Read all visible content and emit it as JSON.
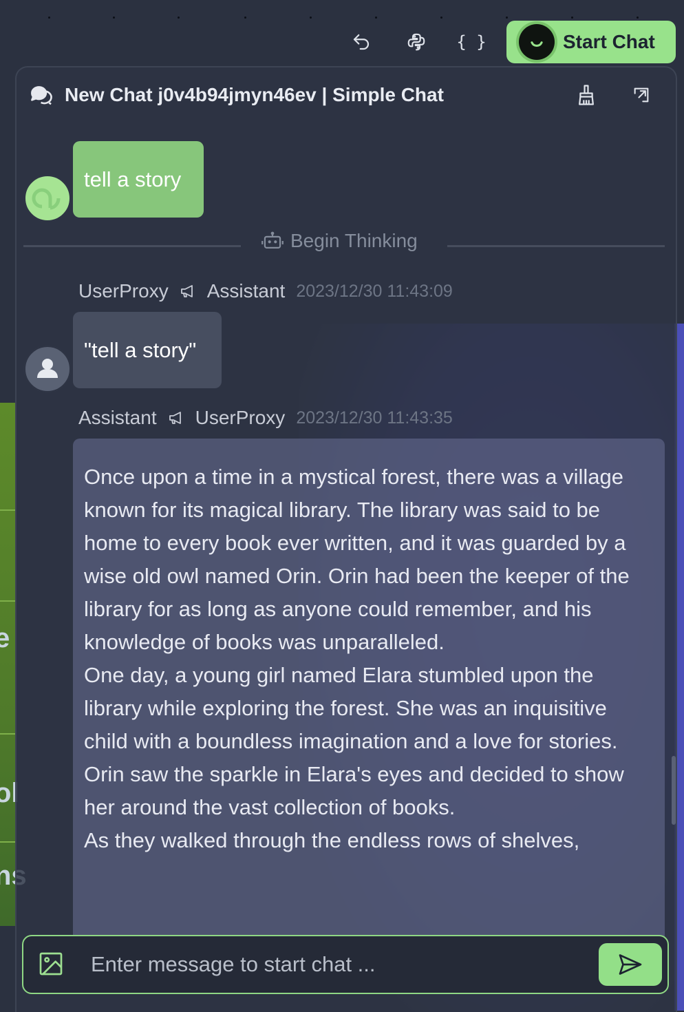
{
  "toolbar": {
    "start_chat_label": "Start Chat",
    "code_label": "{ }"
  },
  "chat": {
    "title": "New Chat j0v4b94jmyn46ev | Simple Chat",
    "user_message": "tell a story",
    "divider_label": "Begin Thinking",
    "messages": [
      {
        "sender": "UserProxy",
        "receiver": "Assistant",
        "timestamp": "2023/12/30 11:43:09",
        "text": "\"tell a story\""
      },
      {
        "sender": "Assistant",
        "receiver": "UserProxy",
        "timestamp": "2023/12/30 11:43:35",
        "paragraphs": [
          "Once upon a time in a mystical forest, there was a village known for its magical library. The library was said to be home to every book ever written, and it was guarded by a wise old owl named Orin. Orin had been the keeper of the library for as long as anyone could remember, and his knowledge of books was unparalleled.",
          "One day, a young girl named Elara stumbled upon the library while exploring the forest. She was an inquisitive child with a boundless imagination and a love for stories. Orin saw the sparkle in Elara's eyes and decided to show her around the vast collection of books.",
          "As they walked through the endless rows of shelves,"
        ]
      }
    ]
  },
  "input": {
    "placeholder": "Enter message to start chat ..."
  },
  "background": {
    "left_fragments": [
      "e",
      "ol",
      "ns"
    ]
  },
  "icons": {
    "undo": "undo-icon",
    "python": "python-icon",
    "code": "code-braces-icon",
    "whatsapp": "whatsapp-icon",
    "chat": "chat-bubbles-icon",
    "clean": "broom-icon",
    "expand": "expand-icon",
    "robot": "robot-icon",
    "announce": "megaphone-icon",
    "image": "image-icon",
    "send": "send-icon"
  },
  "colors": {
    "accent": "#98e28b",
    "background": "#2b3140",
    "user_bubble": "#87c67b",
    "proxy_bubble": "#474e60"
  }
}
